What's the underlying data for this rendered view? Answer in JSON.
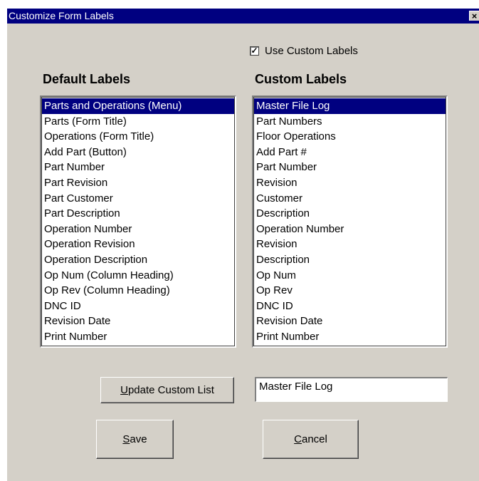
{
  "window": {
    "title": "Customize Form Labels",
    "close_glyph": "×"
  },
  "options": {
    "use_custom_labels_label": "Use Custom Labels",
    "use_custom_labels_checked": true,
    "check_glyph": "✓"
  },
  "default_labels": {
    "heading": "Default Labels",
    "selected_index": 0,
    "items": [
      "Parts and Operations (Menu)",
      "Parts (Form Title)",
      "Operations (Form Title)",
      "Add Part (Button)",
      "Part Number",
      "Part Revision",
      "Part Customer",
      "Part Description",
      "Operation Number",
      "Operation Revision",
      "Operation Description",
      "Op Num (Column Heading)",
      "Op Rev (Column Heading)",
      "DNC ID",
      "Revision Date",
      "Print Number"
    ]
  },
  "custom_labels": {
    "heading": "Custom Labels",
    "selected_index": 0,
    "items": [
      "Master File Log",
      "Part Numbers",
      "Floor Operations",
      "Add Part #",
      "Part Number",
      "Revision",
      "Customer",
      "Description",
      "Operation Number",
      "Revision",
      "Description",
      "Op Num",
      "Op Rev",
      "DNC ID",
      "Revision Date",
      "Print Number"
    ]
  },
  "edit": {
    "update_button": {
      "accel": "U",
      "rest": "pdate Custom List"
    },
    "custom_text_value": "Master File Log"
  },
  "actions": {
    "save": {
      "accel": "S",
      "rest": "ave"
    },
    "cancel": {
      "accel": "C",
      "rest": "ancel"
    }
  }
}
